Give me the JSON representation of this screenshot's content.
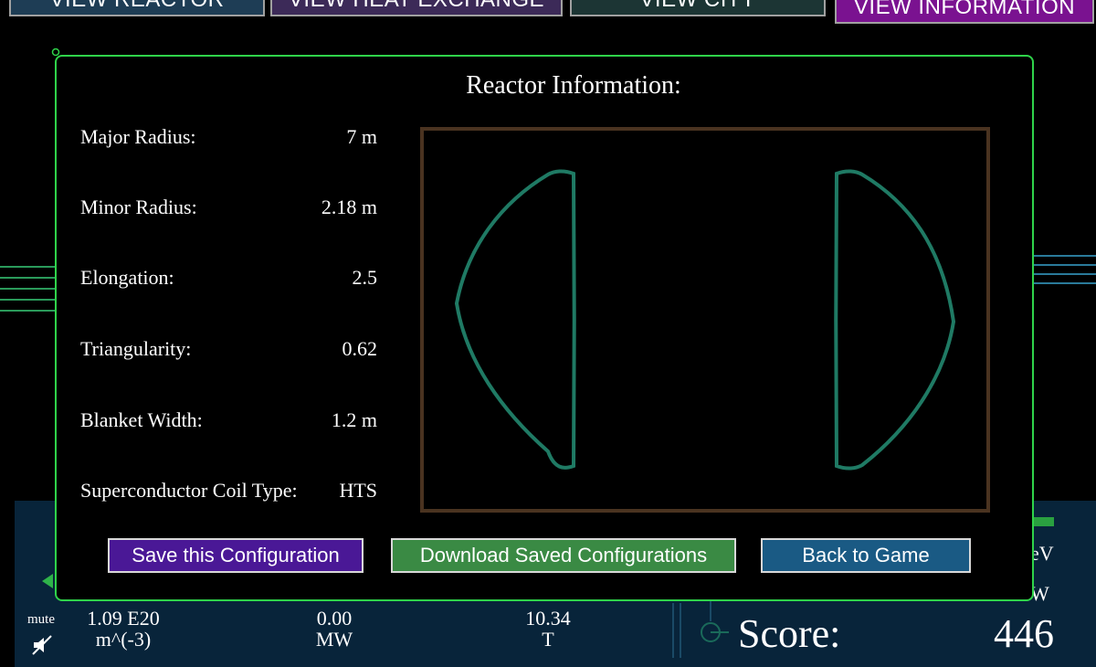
{
  "tabs": {
    "reactor": "VIEW REACTOR",
    "heat": "VIEW HEAT EXCHANGE",
    "city": "VIEW CITY",
    "info": "VIEW INFORMATION"
  },
  "modal": {
    "title": "Reactor Information:",
    "rows": [
      {
        "label": "Major Radius:",
        "value": "7 m"
      },
      {
        "label": "Minor Radius:",
        "value": "2.18 m"
      },
      {
        "label": "Elongation:",
        "value": "2.5"
      },
      {
        "label": "Triangularity:",
        "value": "0.62"
      },
      {
        "label": "Blanket Width:",
        "value": "1.2 m"
      },
      {
        "label": "Superconductor Coil Type:",
        "value": "HTS"
      }
    ],
    "buttons": {
      "save": "Save this Configuration",
      "download": "Download Saved Configurations",
      "back": "Back to Game"
    },
    "diagram": {
      "frame_color": "#4a3320",
      "plasma_color": "#1f7a64"
    }
  },
  "hud": {
    "mute": "mute",
    "density_value": "1.09 E20",
    "density_unit": "m^(-3)",
    "power_value": "0.00",
    "power_unit": "MW",
    "field_value": "10.34",
    "field_unit": "T",
    "right_unit_1": "eV",
    "right_unit_2": "W",
    "score_label": "Score:",
    "score_value": "446"
  },
  "colors": {
    "modal_border": "#2fd34a",
    "hud_panel": "#08243a"
  }
}
